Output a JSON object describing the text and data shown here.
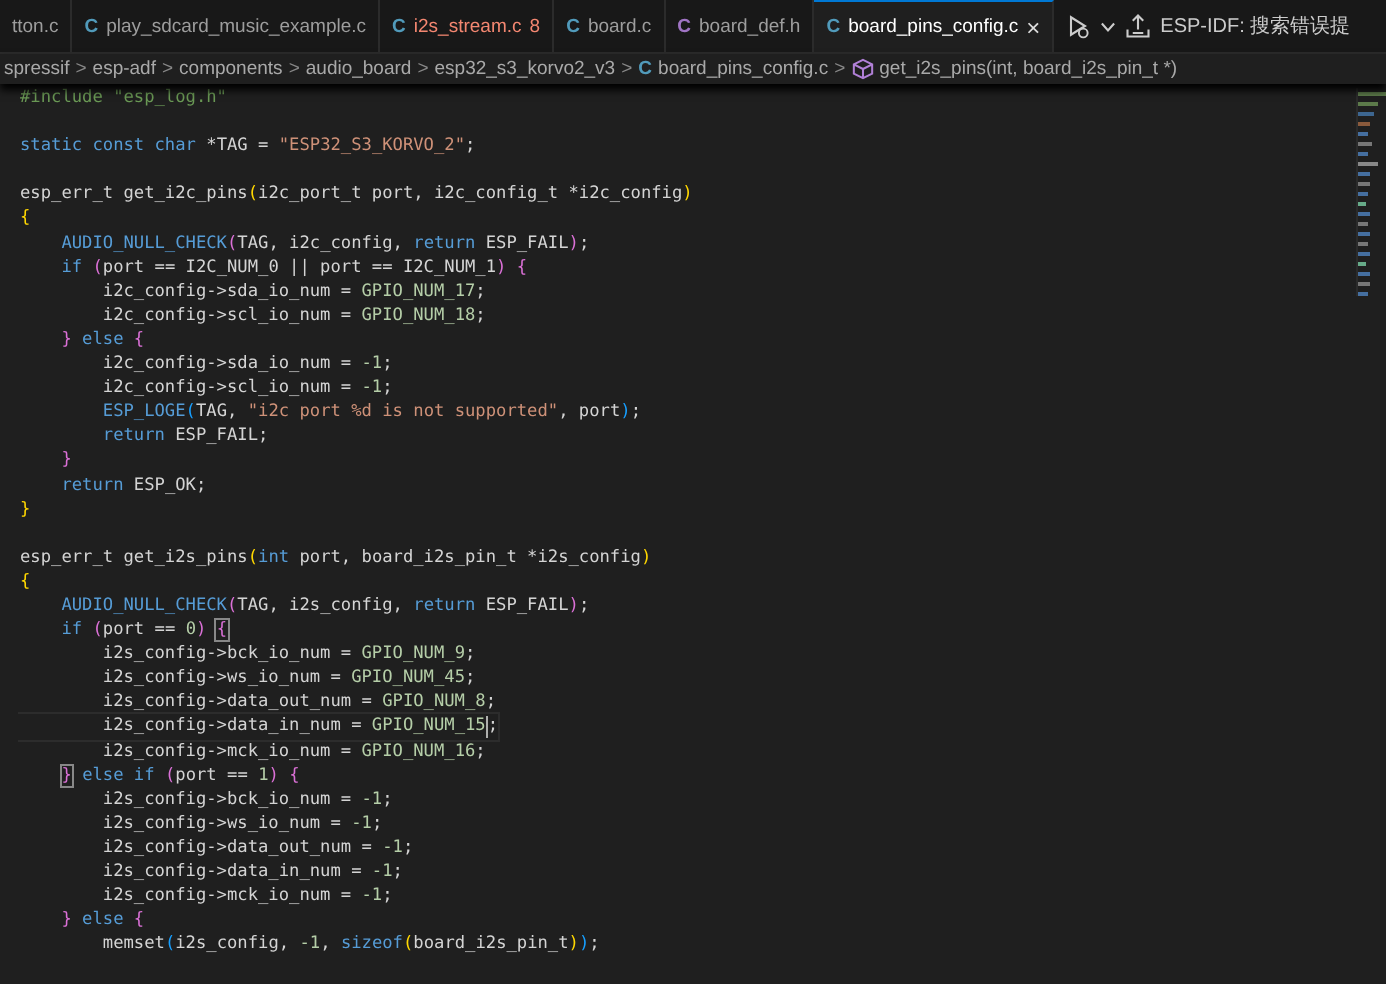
{
  "tabs": [
    {
      "label": "tton.c",
      "error": false,
      "selected": false
    },
    {
      "icon": "C",
      "label": "play_sdcard_music_example.c",
      "color": "#519aba",
      "error": false,
      "selected": false
    },
    {
      "icon": "C",
      "label": "i2s_stream.c",
      "badge": "8",
      "color": "#519aba",
      "error": true,
      "selected": false
    },
    {
      "icon": "C",
      "label": "board.c",
      "color": "#519aba",
      "error": false,
      "selected": false
    },
    {
      "icon": "C",
      "label": "board_def.h",
      "color": "#a074c4",
      "error": false,
      "selected": false
    },
    {
      "icon": "C",
      "label": "board_pins_config.c",
      "close": "×",
      "color": "#519aba",
      "error": false,
      "selected": true
    }
  ],
  "toolbar": {
    "status_text": "ESP-IDF: 搜索错误提"
  },
  "breadcrumbs": {
    "separator": ">",
    "items": [
      {
        "kind": "folder",
        "label": "spressif"
      },
      {
        "kind": "folder",
        "label": "esp-adf"
      },
      {
        "kind": "folder",
        "label": "components"
      },
      {
        "kind": "folder",
        "label": "audio_board"
      },
      {
        "kind": "folder",
        "label": "esp32_s3_korvo2_v3"
      },
      {
        "kind": "file",
        "icon": "C",
        "label": "board_pins_config.c"
      },
      {
        "kind": "symbol",
        "label": "get_i2s_pins(int, board_i2s_pin_t *)"
      }
    ]
  },
  "code": [
    {
      "tokens": [
        {
          "text": "#include \"esp_log.h\"",
          "kind": "comment"
        }
      ]
    },
    {
      "gap_before": true,
      "tokens": [
        {
          "text": "static const char",
          "kind": "keyword"
        },
        {
          "text": " *TAG = ",
          "kind": "plain"
        },
        {
          "text": "\"ESP32_S3_KORVO_2\"",
          "kind": "string"
        },
        {
          "text": ";",
          "kind": "plain"
        }
      ]
    },
    {
      "gap_before": true,
      "tokens": [
        {
          "text": "esp_err_t get_i2c_pins",
          "kind": "plain"
        },
        {
          "text": "(",
          "kind": "bracket1"
        },
        {
          "text": "i2c_port_t port, i2c_config_t *i2c_config",
          "kind": "plain"
        },
        {
          "text": ")",
          "kind": "bracket1"
        }
      ]
    },
    {
      "tokens": [
        {
          "text": "{",
          "kind": "bracket1"
        }
      ]
    },
    {
      "tokens": [
        {
          "text": "    AUDIO_NULL_CHECK",
          "kind": "macro"
        },
        {
          "text": "(",
          "kind": "bracket2"
        },
        {
          "text": "TAG, i2c_config, ",
          "kind": "plain"
        },
        {
          "text": "return",
          "kind": "keyword"
        },
        {
          "text": " ESP_FAIL",
          "kind": "plain"
        },
        {
          "text": ")",
          "kind": "bracket2"
        },
        {
          "text": ";",
          "kind": "plain"
        }
      ]
    },
    {
      "tokens": [
        {
          "text": "    if ",
          "kind": "keyword"
        },
        {
          "text": "(",
          "kind": "bracket2"
        },
        {
          "text": "port == I2C_NUM_0 || port == I2C_NUM_1",
          "kind": "plain"
        },
        {
          "text": ") ",
          "kind": "bracket2"
        },
        {
          "text": "{",
          "kind": "bracket2"
        }
      ]
    },
    {
      "tokens": [
        {
          "text": "        i2c_config->sda_io_num = ",
          "kind": "plain"
        },
        {
          "text": "GPIO_NUM_17",
          "kind": "constant"
        },
        {
          "text": ";",
          "kind": "plain"
        }
      ]
    },
    {
      "tokens": [
        {
          "text": "        i2c_config->scl_io_num = ",
          "kind": "plain"
        },
        {
          "text": "GPIO_NUM_18",
          "kind": "constant"
        },
        {
          "text": ";",
          "kind": "plain"
        }
      ]
    },
    {
      "tokens": [
        {
          "text": "    }",
          "kind": "bracket2"
        },
        {
          "text": " else ",
          "kind": "keyword"
        },
        {
          "text": "{",
          "kind": "bracket2"
        }
      ]
    },
    {
      "tokens": [
        {
          "text": "        i2c_config->sda_io_num = ",
          "kind": "plain"
        },
        {
          "text": "-1",
          "kind": "number"
        },
        {
          "text": ";",
          "kind": "plain"
        }
      ]
    },
    {
      "tokens": [
        {
          "text": "        i2c_config->scl_io_num = ",
          "kind": "plain"
        },
        {
          "text": "-1",
          "kind": "number"
        },
        {
          "text": ";",
          "kind": "plain"
        }
      ]
    },
    {
      "tokens": [
        {
          "text": "        ESP_LOGE",
          "kind": "macro"
        },
        {
          "text": "(",
          "kind": "bracket3"
        },
        {
          "text": "TAG, ",
          "kind": "plain"
        },
        {
          "text": "\"i2c port %d is not supported\"",
          "kind": "string"
        },
        {
          "text": ", port",
          "kind": "plain"
        },
        {
          "text": ")",
          "kind": "bracket3"
        },
        {
          "text": ";",
          "kind": "plain"
        }
      ]
    },
    {
      "tokens": [
        {
          "text": "        return",
          "kind": "keyword"
        },
        {
          "text": " ESP_FAIL;",
          "kind": "plain"
        }
      ]
    },
    {
      "tokens": [
        {
          "text": "    }",
          "kind": "bracket2"
        }
      ]
    },
    {
      "tokens": [
        {
          "text": "    return",
          "kind": "keyword"
        },
        {
          "text": " ESP_OK;",
          "kind": "plain"
        }
      ]
    },
    {
      "tokens": [
        {
          "text": "}",
          "kind": "bracket1"
        }
      ]
    },
    {
      "gap_before": true,
      "tokens": [
        {
          "text": "esp_err_t get_i2s_pins",
          "kind": "plain"
        },
        {
          "text": "(",
          "kind": "bracket1"
        },
        {
          "text": "int",
          "kind": "keyword"
        },
        {
          "text": " port, board_i2s_pin_t *i2s_config",
          "kind": "plain"
        },
        {
          "text": ")",
          "kind": "bracket1"
        }
      ]
    },
    {
      "tokens": [
        {
          "text": "{",
          "kind": "bracket1"
        }
      ]
    },
    {
      "tokens": [
        {
          "text": "    AUDIO_NULL_CHECK",
          "kind": "macro"
        },
        {
          "text": "(",
          "kind": "bracket2"
        },
        {
          "text": "TAG, i2s_config, ",
          "kind": "plain"
        },
        {
          "text": "return",
          "kind": "keyword"
        },
        {
          "text": " ESP_FAIL",
          "kind": "plain"
        },
        {
          "text": ")",
          "kind": "bracket2"
        },
        {
          "text": ";",
          "kind": "plain"
        }
      ]
    },
    {
      "tokens": [
        {
          "text": "    if ",
          "kind": "keyword"
        },
        {
          "text": "(",
          "kind": "bracket2"
        },
        {
          "text": "port == ",
          "kind": "plain"
        },
        {
          "text": "0",
          "kind": "number"
        },
        {
          "text": ") ",
          "kind": "bracket2"
        },
        {
          "text": "{",
          "kind": "bracket2",
          "matched": true
        }
      ]
    },
    {
      "tokens": [
        {
          "text": "        i2s_config->bck_io_num = ",
          "kind": "plain"
        },
        {
          "text": "GPIO_NUM_9",
          "kind": "constant"
        },
        {
          "text": ";",
          "kind": "plain"
        }
      ]
    },
    {
      "tokens": [
        {
          "text": "        i2s_config->ws_io_num = ",
          "kind": "plain"
        },
        {
          "text": "GPIO_NUM_45",
          "kind": "constant"
        },
        {
          "text": ";",
          "kind": "plain"
        }
      ]
    },
    {
      "tokens": [
        {
          "text": "        i2s_config->data_out_num = ",
          "kind": "plain"
        },
        {
          "text": "GPIO_NUM_8",
          "kind": "constant"
        },
        {
          "text": ";",
          "kind": "plain"
        }
      ]
    },
    {
      "current": true,
      "tokens": [
        {
          "text": "        i2s_config->data_in_num = ",
          "kind": "plain"
        },
        {
          "text": "GPIO_NUM_15",
          "kind": "constant",
          "cursor_after": true
        },
        {
          "text": ";",
          "kind": "plain"
        }
      ]
    },
    {
      "tokens": [
        {
          "text": "        i2s_config->mck_io_num = ",
          "kind": "plain"
        },
        {
          "text": "GPIO_NUM_16",
          "kind": "constant"
        },
        {
          "text": ";",
          "kind": "plain"
        }
      ]
    },
    {
      "tokens": [
        {
          "text": "    }",
          "kind": "bracket2",
          "matched": true
        },
        {
          "text": " else if ",
          "kind": "keyword"
        },
        {
          "text": "(",
          "kind": "bracket2"
        },
        {
          "text": "port == ",
          "kind": "plain"
        },
        {
          "text": "1",
          "kind": "number"
        },
        {
          "text": ") ",
          "kind": "bracket2"
        },
        {
          "text": "{",
          "kind": "bracket2"
        }
      ]
    },
    {
      "tokens": [
        {
          "text": "        i2s_config->bck_io_num = ",
          "kind": "plain"
        },
        {
          "text": "-1",
          "kind": "number"
        },
        {
          "text": ";",
          "kind": "plain"
        }
      ]
    },
    {
      "tokens": [
        {
          "text": "        i2s_config->ws_io_num = ",
          "kind": "plain"
        },
        {
          "text": "-1",
          "kind": "number"
        },
        {
          "text": ";",
          "kind": "plain"
        }
      ]
    },
    {
      "tokens": [
        {
          "text": "        i2s_config->data_out_num = ",
          "kind": "plain"
        },
        {
          "text": "-1",
          "kind": "number"
        },
        {
          "text": ";",
          "kind": "plain"
        }
      ]
    },
    {
      "tokens": [
        {
          "text": "        i2s_config->data_in_num = ",
          "kind": "plain"
        },
        {
          "text": "-1",
          "kind": "number"
        },
        {
          "text": ";",
          "kind": "plain"
        }
      ]
    },
    {
      "tokens": [
        {
          "text": "        i2s_config->mck_io_num = ",
          "kind": "plain"
        },
        {
          "text": "-1",
          "kind": "number"
        },
        {
          "text": ";",
          "kind": "plain"
        }
      ]
    },
    {
      "tokens": [
        {
          "text": "    }",
          "kind": "bracket2"
        },
        {
          "text": " else ",
          "kind": "keyword"
        },
        {
          "text": "{",
          "kind": "bracket2"
        }
      ]
    },
    {
      "tokens": [
        {
          "text": "        memset",
          "kind": "plain"
        },
        {
          "text": "(",
          "kind": "bracket3"
        },
        {
          "text": "i2s_config, ",
          "kind": "plain"
        },
        {
          "text": "-1",
          "kind": "number"
        },
        {
          "text": ", ",
          "kind": "plain"
        },
        {
          "text": "sizeof",
          "kind": "keyword"
        },
        {
          "text": "(",
          "kind": "bracket1"
        },
        {
          "text": "board_i2s_pin_t",
          "kind": "plain"
        },
        {
          "text": ")",
          "kind": "bracket1"
        },
        {
          "text": ")",
          "kind": "bracket3"
        },
        {
          "text": ";",
          "kind": "plain"
        }
      ]
    }
  ]
}
